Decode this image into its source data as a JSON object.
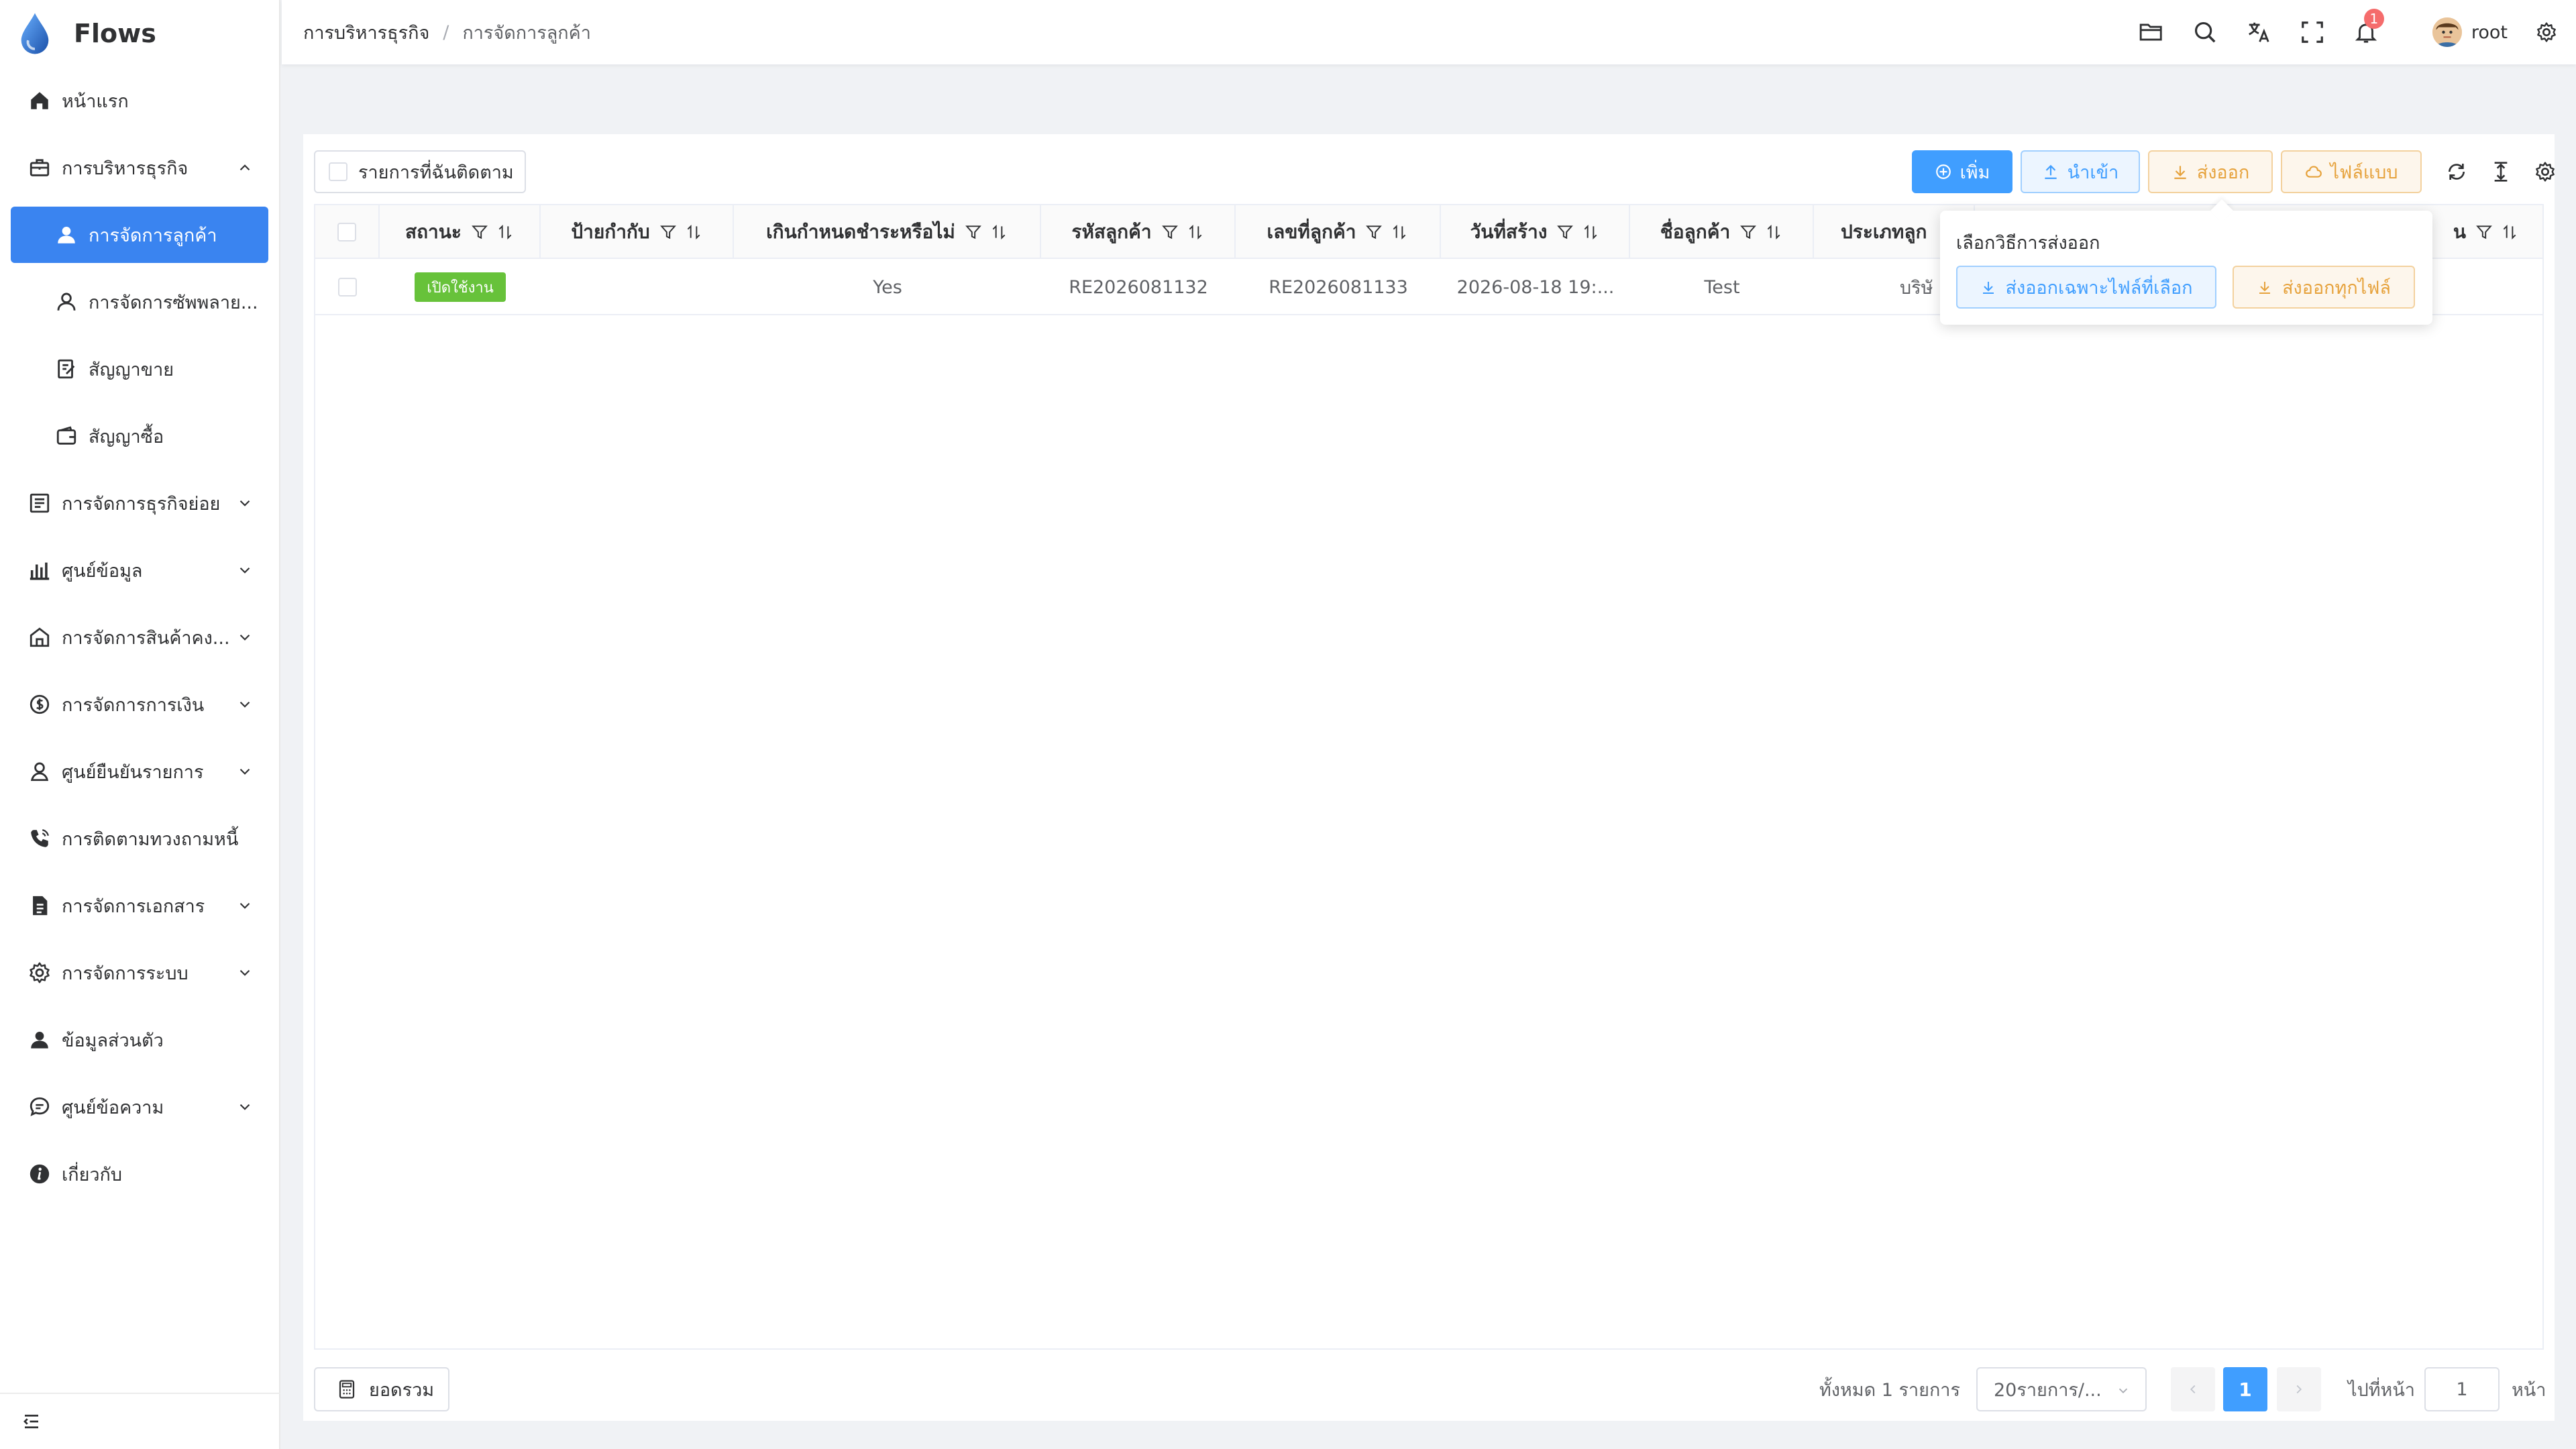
{
  "app": {
    "title": "Flows"
  },
  "colors": {
    "primary": "#409eff",
    "sidebar_active": "#3a84f0",
    "success": "#67c23a",
    "warning": "#e6a23c",
    "danger": "#f56c6c"
  },
  "sidebar": {
    "home": "หน้าแรก",
    "business": "การบริหารธุรกิจ",
    "customers": "การจัดการลูกค้า",
    "suppliers": "การจัดการซัพพลาย...",
    "sales_contract": "สัญญาขาย",
    "purchase_contract": "สัญญาซื้อ",
    "sub_business": "การจัดการธุรกิจย่อย",
    "data_center": "ศูนย์ข้อมูล",
    "inventory": "การจัดการสินค้าคง...",
    "finance": "การจัดการการเงิน",
    "confirm_center": "ศูนย์ยืนยันรายการ",
    "debt_tracking": "การติดตามทวงถามหนี้",
    "documents": "การจัดการเอกสาร",
    "system": "การจัดการระบบ",
    "profile": "ข้อมูลส่วนตัว",
    "messages": "ศูนย์ข้อความ",
    "about": "เกี่ยวกับ"
  },
  "header": {
    "breadcrumb_1": "การบริหารธุรกิจ",
    "breadcrumb_sep": "/",
    "breadcrumb_2": "การจัดการลูกค้า",
    "notification_count": "1",
    "username": "root"
  },
  "toolbar": {
    "follow_label": "รายการที่ฉันติดตาม",
    "add": "เพิ่ม",
    "import": "นำเข้า",
    "export": "ส่งออก",
    "template": "ไฟล์แบบ"
  },
  "table": {
    "columns": [
      "สถานะ",
      "ป้ายกำกับ",
      "เกินกำหนดชำระหรือไม่",
      "รหัสลูกค้า",
      "เลขที่ลูกค้า",
      "วันที่สร้าง",
      "ชื่อลูกค้า",
      "ประเภทลูก",
      "น"
    ],
    "rows": [
      {
        "status": "เปิดใช้งาน",
        "label": "",
        "overdue": "Yes",
        "code": "RE2026081132",
        "number": "RE2026081133",
        "created": "2026-08-18 19:...",
        "name": "Test",
        "type": "บริษั"
      }
    ]
  },
  "export_popover": {
    "title": "เลือกวิธีการส่งออก",
    "selected": "ส่งออกเฉพาะไฟล์ที่เลือก",
    "all": "ส่งออกทุกไฟล์"
  },
  "footer": {
    "summary": "ยอดรวม",
    "total": "ทั้งหมด 1 รายการ",
    "page_size": "20รายการ/...",
    "current_page": "1",
    "goto": "ไปที่หน้า",
    "goto_value": "1",
    "page_unit": "หน้า"
  }
}
